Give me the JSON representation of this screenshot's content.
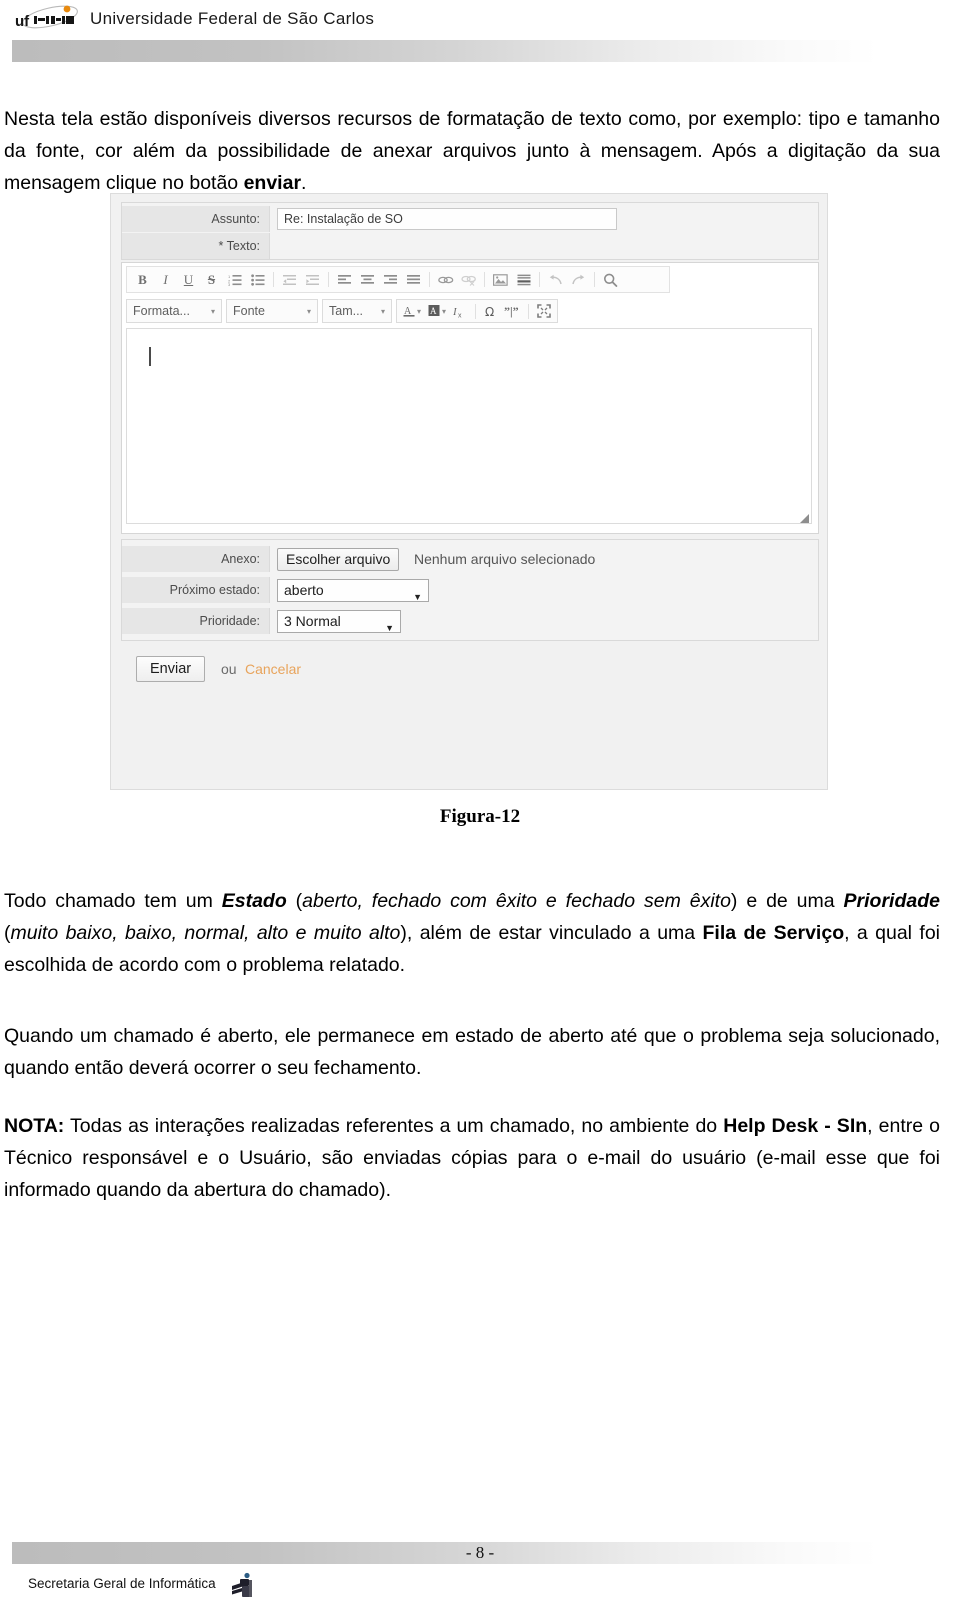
{
  "header": {
    "university": "Universidade Federal de São Carlos",
    "logo_icon": "ufscar-logo-icon"
  },
  "intro_paragraph": {
    "line1": "Nesta tela estão disponíveis diversos recursos de formatação de texto como, por exemplo: tipo e tamanho da fonte, cor além da possibilidade de anexar arquivos junto à mensagem. Após a digitação da sua mensagem clique no botão ",
    "bold_word": "enviar",
    "tail": "."
  },
  "figure": {
    "caption": "Figura-12",
    "form": {
      "subject": {
        "label": "Assunto:",
        "value": "Re: Instalação de SO",
        "placeholder": ""
      },
      "body": {
        "label": "* Texto:",
        "value": "",
        "caret_visible": true
      },
      "toolbar_row1": [
        {
          "name": "bold-icon",
          "glyph": "B"
        },
        {
          "name": "italic-icon",
          "glyph": "I"
        },
        {
          "name": "underline-icon",
          "glyph": "U"
        },
        {
          "name": "strikethrough-icon",
          "glyph": "S"
        },
        {
          "name": "ordered-list-icon",
          "glyph": "list-numbered"
        },
        {
          "name": "unordered-list-icon",
          "glyph": "list-bullet"
        },
        {
          "name": "outdent-icon",
          "glyph": "outdent"
        },
        {
          "name": "indent-icon",
          "glyph": "indent"
        },
        {
          "name": "align-left-icon",
          "glyph": "align-left"
        },
        {
          "name": "align-center-icon",
          "glyph": "align-center"
        },
        {
          "name": "align-right-icon",
          "glyph": "align-right"
        },
        {
          "name": "align-justify-icon",
          "glyph": "align-justify"
        },
        {
          "name": "insert-link-icon",
          "glyph": "link"
        },
        {
          "name": "remove-link-icon",
          "glyph": "unlink"
        },
        {
          "name": "insert-image-icon",
          "glyph": "image"
        },
        {
          "name": "horizontal-rule-icon",
          "glyph": "hrule"
        },
        {
          "name": "undo-icon",
          "glyph": "undo"
        },
        {
          "name": "redo-icon",
          "glyph": "redo"
        },
        {
          "name": "find-icon",
          "glyph": "search"
        }
      ],
      "toolbar_row2": {
        "format_select": "Formata...",
        "font_select": "Fonte",
        "size_select": "Tam...",
        "text_color_icon": "text-color-icon",
        "background_color_icon": "background-color-icon",
        "remove_format_icon": "remove-format-icon",
        "special_char_icon": "special-character-icon",
        "blockquote_icon": "blockquote-icon",
        "fullscreen_icon": "fullscreen-icon"
      },
      "attachment": {
        "label": "Anexo:",
        "button": "Escolher arquivo",
        "status": "Nenhum arquivo selecionado"
      },
      "next_state": {
        "label": "Próximo estado:",
        "value": "aberto"
      },
      "priority": {
        "label": "Prioridade:",
        "value": "3 Normal"
      },
      "submit": {
        "button": "Enviar",
        "or_text": "ou",
        "cancel_link": "Cancelar",
        "cancel_color": "#e8a45c"
      }
    }
  },
  "estado_paragraph": {
    "t1": "Todo chamado tem um ",
    "b1": "Estado",
    "t2": " (",
    "i1": "aberto, fechado com êxito e fechado sem êxito",
    "t3": ") e de uma ",
    "b2": "Prioridade",
    "t4": " (",
    "i2": "muito baixo, baixo, normal, alto e muito alto",
    "t5": "), além de estar vinculado a uma ",
    "b3": "Fila de Serviço",
    "t6": ", a qual foi escolhida de acordo com o problema relatado."
  },
  "aberto_paragraph": {
    "text": "Quando um chamado é aberto, ele permanece em estado de aberto até que o problema seja solucionado, quando então deverá ocorrer o seu fechamento."
  },
  "nota_paragraph": {
    "label": "NOTA:",
    "t1": " Todas as interações realizadas referentes a um chamado, no ambiente do ",
    "b1": "Help Desk - SIn",
    "t2": ", entre o Técnico responsável e o Usuário, são enviadas cópias para o e-mail do usuário (e-mail esse que foi informado quando da abertura do chamado)."
  },
  "footer": {
    "page_number": "- 8 -",
    "department": "Secretaria Geral de Informática",
    "logo_icon": "sin-logo-icon"
  }
}
